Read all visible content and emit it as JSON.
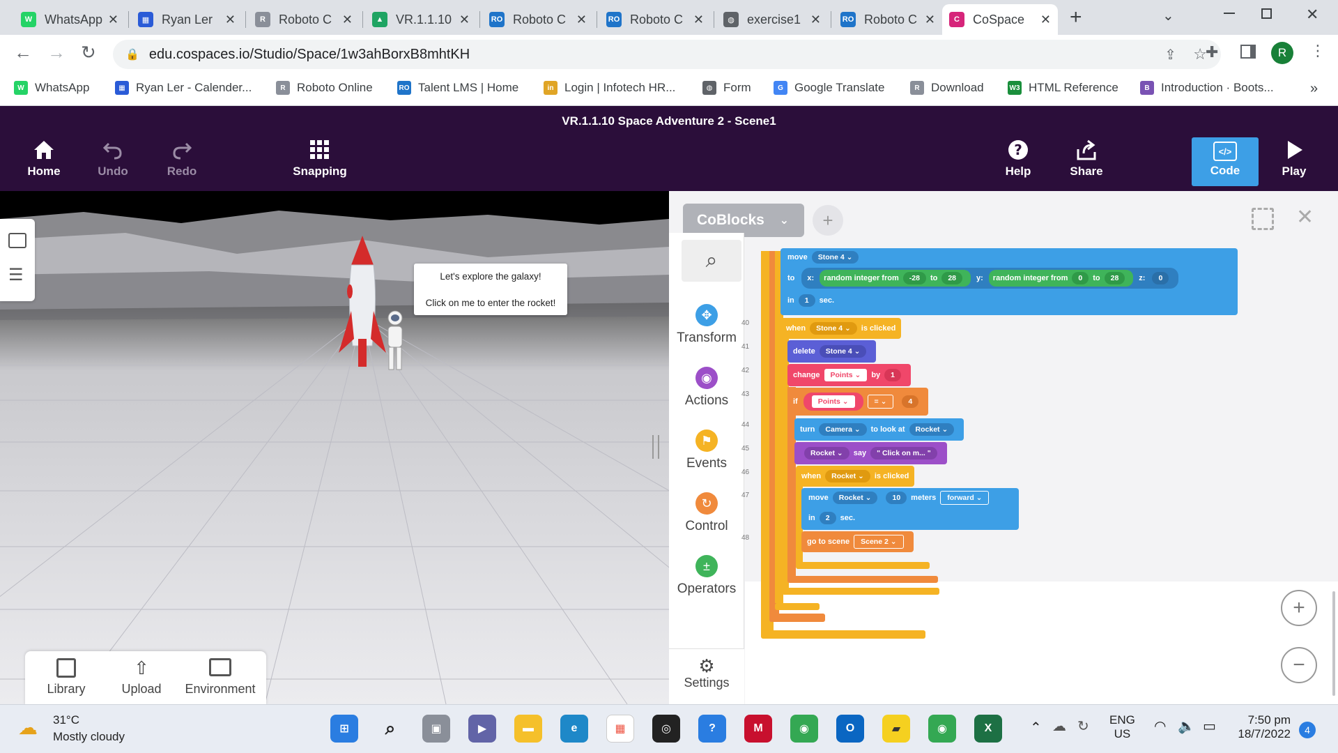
{
  "browser": {
    "tabs": [
      {
        "title": "WhatsApp",
        "color": "#25d366",
        "glyph": "W"
      },
      {
        "title": "Ryan Ler",
        "color": "#2a5bd7",
        "glyph": "▦"
      },
      {
        "title": "Roboto C",
        "color": "#8a8f99",
        "glyph": "R"
      },
      {
        "title": "VR.1.1.10",
        "color": "#1fa463",
        "glyph": "▲"
      },
      {
        "title": "Roboto C",
        "color": "#1f74c9",
        "glyph": "RO"
      },
      {
        "title": "Roboto C",
        "color": "#1f74c9",
        "glyph": "RO"
      },
      {
        "title": "exercise1",
        "color": "#5f6368",
        "glyph": "◍"
      },
      {
        "title": "Roboto C",
        "color": "#1f74c9",
        "glyph": "RO"
      },
      {
        "title": "CoSpace",
        "color": "#d6257a",
        "glyph": "C"
      }
    ],
    "new_tab": "+",
    "url": "edu.cospaces.io/Studio/Space/1w3ahBorxB8mhtKH",
    "profile_letter": "R",
    "bookmarks": [
      {
        "label": "WhatsApp",
        "color": "#25d366",
        "glyph": "W"
      },
      {
        "label": "Ryan Ler - Calender...",
        "color": "#2a5bd7",
        "glyph": "▦"
      },
      {
        "label": "Roboto Online",
        "color": "#8a8f99",
        "glyph": "R"
      },
      {
        "label": "Talent LMS | Home",
        "color": "#1f74c9",
        "glyph": "RO"
      },
      {
        "label": "Login | Infotech HR...",
        "color": "#e0a526",
        "glyph": "in"
      },
      {
        "label": "Form",
        "color": "#5f6368",
        "glyph": "◍"
      },
      {
        "label": "Google Translate",
        "color": "#4285f4",
        "glyph": "G"
      },
      {
        "label": "Download",
        "color": "#8a8f99",
        "glyph": "R"
      },
      {
        "label": "HTML Reference",
        "color": "#1a8f3c",
        "glyph": "W3"
      },
      {
        "label": "Introduction · Boots...",
        "color": "#7952b3",
        "glyph": "B"
      }
    ],
    "more_bookmarks": "»"
  },
  "app": {
    "scene_title": "VR.1.1.10 Space Adventure 2 - Scene1",
    "buttons": {
      "home": "Home",
      "undo": "Undo",
      "redo": "Redo",
      "snapping": "Snapping",
      "help": "Help",
      "share": "Share",
      "code": "Code",
      "play": "Play"
    },
    "accent": "#3d9fe6",
    "speech": {
      "line1": "Let's explore the galaxy!",
      "line2": "Click on me to enter the rocket!"
    },
    "bottom_tools": {
      "library": "Library",
      "upload": "Upload",
      "environment": "Environment"
    }
  },
  "code": {
    "selector": "CoBlocks",
    "categories": [
      "Transform",
      "Actions",
      "Events",
      "Control",
      "Operators"
    ],
    "settings": "Settings",
    "line_numbers": [
      "40",
      "41",
      "42",
      "43",
      "44",
      "45",
      "46",
      "47",
      "48"
    ],
    "blocks": {
      "move_kw": "move",
      "stone4": "Stone 4",
      "to_kw": "to",
      "x_kw": "x:",
      "rand": "random integer from",
      "neg28": "-28",
      "to2": "to",
      "n28": "28",
      "y_kw": "y:",
      "zero": "0",
      "z_kw": "z:",
      "in_kw": "in",
      "one": "1",
      "sec": "sec.",
      "when": "when",
      "is_clicked": "is clicked",
      "delete": "delete",
      "change": "change",
      "points": "Points",
      "by": "by",
      "if": "if",
      "eq": "=",
      "four": "4",
      "turn": "turn",
      "camera": "Camera",
      "to_look_at": "to look at",
      "rocket": "Rocket",
      "say": "say",
      "say_text": "\" Click on m... \"",
      "meters": "meters",
      "ten": "10",
      "forward": "forward",
      "two": "2",
      "go_to_scene": "go to scene",
      "scene2": "Scene 2"
    }
  },
  "taskbar": {
    "temp": "31°C",
    "weather": "Mostly cloudy",
    "lang1": "ENG",
    "lang2": "US",
    "time": "7:50 pm",
    "date": "18/7/2022",
    "badge": "4"
  }
}
